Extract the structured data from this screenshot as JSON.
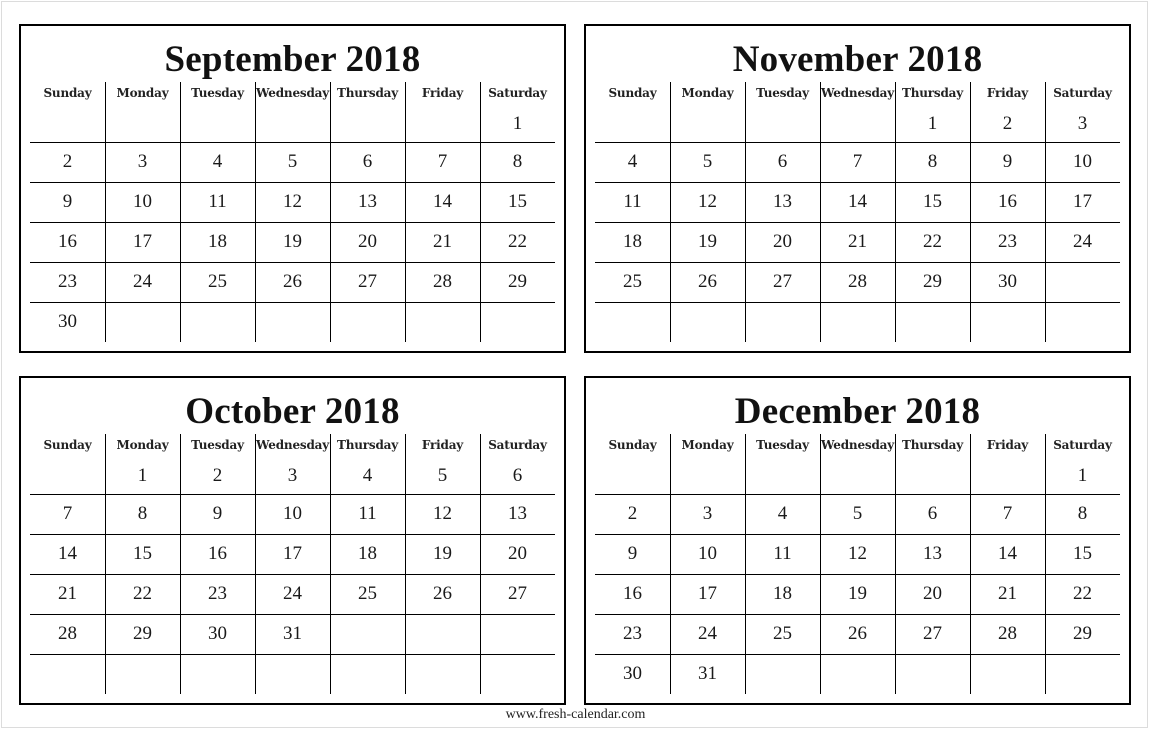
{
  "weekdays": [
    "Sunday",
    "Monday",
    "Tuesday",
    "Wednesday",
    "Thursday",
    "Friday",
    "Saturday"
  ],
  "calendars": [
    {
      "title": "September 2018",
      "weeks": [
        [
          "",
          "",
          "",
          "",
          "",
          "",
          "1"
        ],
        [
          "2",
          "3",
          "4",
          "5",
          "6",
          "7",
          "8"
        ],
        [
          "9",
          "10",
          "11",
          "12",
          "13",
          "14",
          "15"
        ],
        [
          "16",
          "17",
          "18",
          "19",
          "20",
          "21",
          "22"
        ],
        [
          "23",
          "24",
          "25",
          "26",
          "27",
          "28",
          "29"
        ],
        [
          "30",
          "",
          "",
          "",
          "",
          "",
          ""
        ]
      ]
    },
    {
      "title": "November 2018",
      "weeks": [
        [
          "",
          "",
          "",
          "",
          "1",
          "2",
          "3"
        ],
        [
          "4",
          "5",
          "6",
          "7",
          "8",
          "9",
          "10"
        ],
        [
          "11",
          "12",
          "13",
          "14",
          "15",
          "16",
          "17"
        ],
        [
          "18",
          "19",
          "20",
          "21",
          "22",
          "23",
          "24"
        ],
        [
          "25",
          "26",
          "27",
          "28",
          "29",
          "30",
          ""
        ],
        [
          "",
          "",
          "",
          "",
          "",
          "",
          ""
        ]
      ]
    },
    {
      "title": "October 2018",
      "weeks": [
        [
          "",
          "1",
          "2",
          "3",
          "4",
          "5",
          "6"
        ],
        [
          "7",
          "8",
          "9",
          "10",
          "11",
          "12",
          "13"
        ],
        [
          "14",
          "15",
          "16",
          "17",
          "18",
          "19",
          "20"
        ],
        [
          "21",
          "22",
          "23",
          "24",
          "25",
          "26",
          "27"
        ],
        [
          "28",
          "29",
          "30",
          "31",
          "",
          "",
          ""
        ],
        [
          "",
          "",
          "",
          "",
          "",
          "",
          ""
        ]
      ]
    },
    {
      "title": "December 2018",
      "weeks": [
        [
          "",
          "",
          "",
          "",
          "",
          "",
          "1"
        ],
        [
          "2",
          "3",
          "4",
          "5",
          "6",
          "7",
          "8"
        ],
        [
          "9",
          "10",
          "11",
          "12",
          "13",
          "14",
          "15"
        ],
        [
          "16",
          "17",
          "18",
          "19",
          "20",
          "21",
          "22"
        ],
        [
          "23",
          "24",
          "25",
          "26",
          "27",
          "28",
          "29"
        ],
        [
          "30",
          "31",
          "",
          "",
          "",
          "",
          ""
        ]
      ]
    }
  ],
  "footer": {
    "url_text": "www.fresh-calendar.com"
  }
}
